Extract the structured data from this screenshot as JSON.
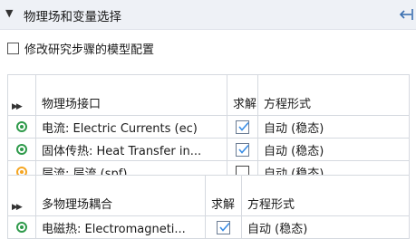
{
  "section": {
    "title": "物理场和变量选择"
  },
  "modify_config": {
    "label": "修改研究步骤的模型配置",
    "checked": false
  },
  "physics_table": {
    "columns": [
      "物理场接口",
      "求解",
      "方程形式"
    ],
    "rows": [
      {
        "name": "电流: Electric Currents (ec)",
        "status": "ok",
        "solve": true,
        "form": "自动 (稳态)"
      },
      {
        "name": "固体传热: Heat Transfer in...",
        "status": "ok",
        "solve": true,
        "form": "自动 (稳态)"
      },
      {
        "name": "层流: 层流 (spf)",
        "status": "warning",
        "solve": false,
        "form": "自动 (稳态)"
      }
    ]
  },
  "multiphysics_table": {
    "columns": [
      "多物理场耦合",
      "求解",
      "方程形式"
    ],
    "rows": [
      {
        "name": "电磁热: Electromagneti...",
        "status": "ok",
        "solve": true,
        "form": "自动 (稳态)"
      }
    ]
  },
  "colors": {
    "ok": "#2e9a4a",
    "warning": "#f5a623",
    "check": "#3a8ee6"
  }
}
